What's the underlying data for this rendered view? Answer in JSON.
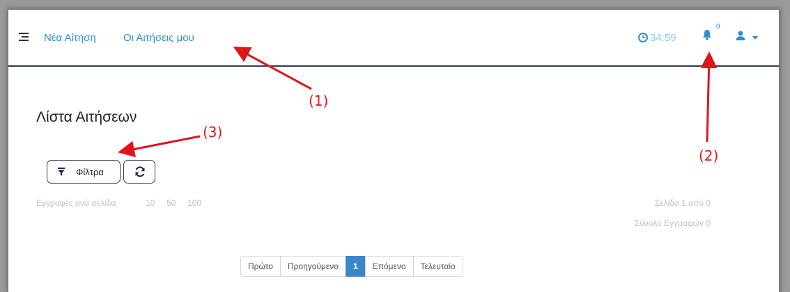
{
  "nav": {
    "menu_icon": "menu-icon",
    "links": [
      "Νέα Αίτηση",
      "Οι Αιτήσεις μου"
    ],
    "timer": "34:59",
    "notification_count": "0",
    "accent_color": "#2a8fd0"
  },
  "main": {
    "title": "Λίστα Αιτήσεων",
    "filter_button": "Φίλτρα",
    "refresh_icon": "refresh-icon",
    "per_page_label": "Εγγραφές ανά σελίδα",
    "per_page_options": [
      "10",
      "50",
      "100"
    ],
    "page_info": "Σελίδα 1 από 0",
    "total_info": "Σύνολο Εγγραφών 0"
  },
  "pagination": {
    "first": "Πρώτο",
    "previous": "Προηγούμενο",
    "current": "1",
    "next": "Επόμενο",
    "last": "Τελευταίο"
  },
  "annotations": {
    "callout_1": "(1)",
    "callout_2": "(2)",
    "callout_3": "(3)",
    "color": "#e0151b"
  }
}
